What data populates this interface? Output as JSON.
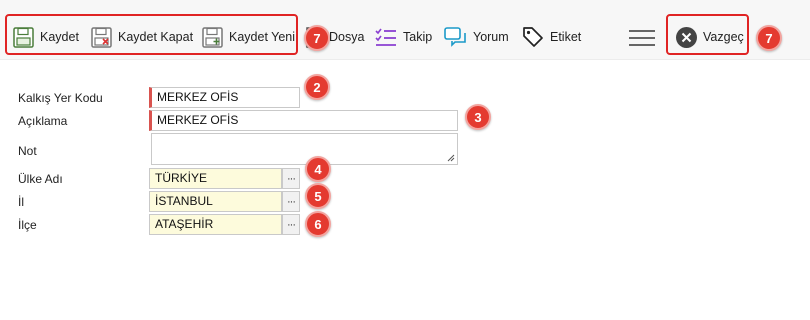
{
  "toolbar": {
    "kaydet": "Kaydet",
    "kaydet_kapat": "Kaydet Kapat",
    "kaydet_yeni": "Kaydet Yeni",
    "dosya": "Dosya",
    "takip": "Takip",
    "yorum": "Yorum",
    "etiket": "Etiket",
    "vazgec": "Vazgeç"
  },
  "form": {
    "kalkis_yer_kodu": {
      "label": "Kalkış Yer Kodu",
      "value": "MERKEZ OFİS"
    },
    "aciklama": {
      "label": "Açıklama",
      "value": "MERKEZ OFİS"
    },
    "not": {
      "label": "Not",
      "value": ""
    },
    "ulke_adi": {
      "label": "Ülke Adı",
      "value": "TÜRKİYE"
    },
    "il": {
      "label": "İl",
      "value": "İSTANBUL"
    },
    "ilce": {
      "label": "İlçe",
      "value": "ATAŞEHİR"
    },
    "lookup_label": "···"
  },
  "annotations": {
    "badge_toolbar": "7",
    "badge_kalkis": "2",
    "badge_aciklama": "3",
    "badge_ulke": "4",
    "badge_il": "5",
    "badge_ilce": "6",
    "badge_vazgec": "7"
  },
  "colors": {
    "highlight": "#e02424",
    "badge": "#e43a30",
    "required_marker": "#d9534f",
    "lookup_field_bg": "#fdfbdc",
    "icon_purple": "#8a3fd1",
    "icon_cyan": "#1b9ac9"
  },
  "icons": [
    "save-icon",
    "save-close-icon",
    "save-new-icon",
    "file-icon",
    "checklist-icon",
    "comment-icon",
    "tag-icon",
    "hamburger-menu-icon",
    "close-circle-icon"
  ]
}
